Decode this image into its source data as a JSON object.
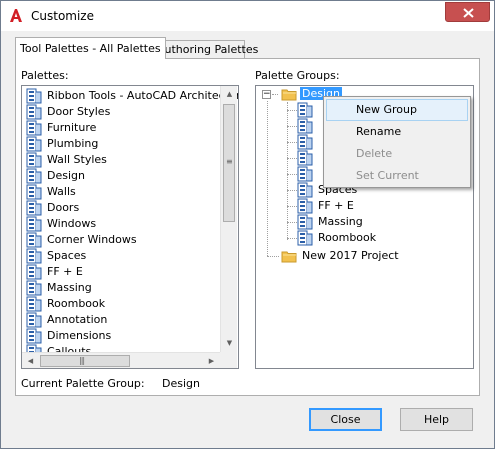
{
  "window": {
    "title": "Customize"
  },
  "tabs": [
    {
      "label": "Tool Palettes - All Palettes",
      "active": true
    },
    {
      "label": "Authoring Palettes",
      "active": false
    }
  ],
  "palettes": {
    "label": "Palettes:",
    "items": [
      "Ribbon Tools - AutoCAD Architecture",
      "Door Styles",
      "Furniture",
      "Plumbing",
      "Wall Styles",
      "Design",
      "Walls",
      "Doors",
      "Windows",
      "Corner Windows",
      "Spaces",
      "FF + E",
      "Massing",
      "Roombook",
      "Annotation",
      "Dimensions",
      "Callouts"
    ]
  },
  "palette_groups": {
    "label": "Palette Groups:",
    "root": "Design",
    "children": [
      "Spaces",
      "FF + E",
      "Massing",
      "Roombook"
    ],
    "other_group": "New 2017 Project"
  },
  "context_menu": {
    "items": [
      {
        "label": "New Group",
        "enabled": true,
        "hovered": true
      },
      {
        "label": "Rename",
        "enabled": true
      },
      {
        "label": "Delete",
        "enabled": false
      },
      {
        "label": "Set Current",
        "enabled": false
      }
    ]
  },
  "current_group": {
    "label": "Current Palette Group:",
    "value": "Design"
  },
  "buttons": {
    "close": "Close",
    "help": "Help"
  },
  "colors": {
    "selection": "#3399ff",
    "close_button": "#c75050",
    "menu_hover": "#e5f1fb"
  }
}
